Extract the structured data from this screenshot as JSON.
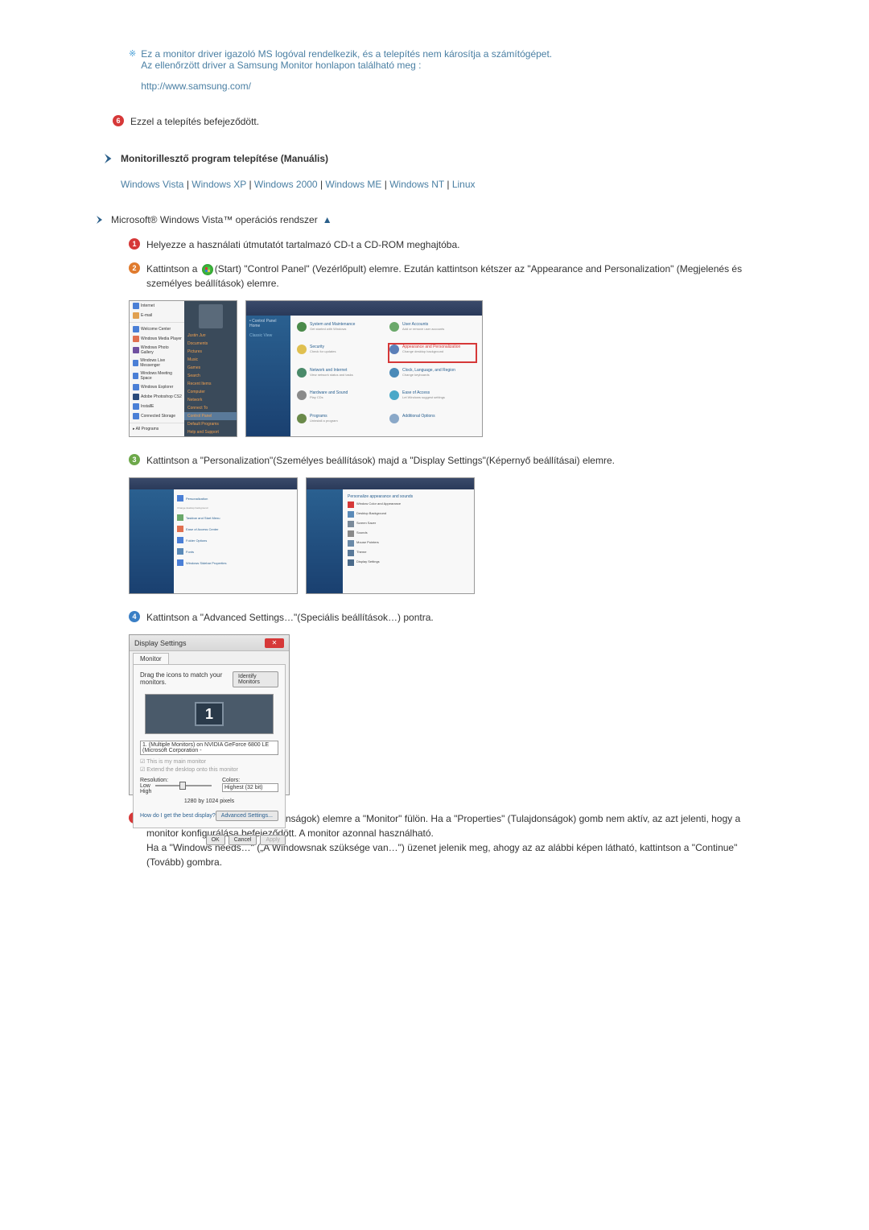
{
  "note": {
    "line1": "Ez a monitor driver igazoló MS logóval rendelkezik, és a telepítés nem károsítja a számítógépet.",
    "line2": "Az ellenőrzött driver a Samsung Monitor honlapon található meg :",
    "url": "http://www.samsung.com/"
  },
  "step6": "Ezzel a telepítés befejeződött.",
  "section_manual": "Monitorillesztő program telepítése (Manuális)",
  "os_links": {
    "vista": "Windows Vista",
    "xp": "Windows XP",
    "w2000": "Windows 2000",
    "me": "Windows ME",
    "nt": "Windows NT",
    "linux": "Linux"
  },
  "vista_title": "Microsoft® Windows Vista™ operációs rendszer",
  "vista_steps": {
    "s1": "Helyezze a használati útmutatót tartalmazó CD-t a CD-ROM meghajtóba.",
    "s2a": "Kattintson a ",
    "s2b": "(Start) \"Control Panel\" (Vezérlőpult) elemre. Ezután kattintson kétszer az \"Appearance and Personalization\" (Megjelenés és személyes beállítások) elemre.",
    "s3": "Kattintson a \"Personalization\"(Személyes beállítások) majd a \"Display Settings\"(Képernyő beállításai) elemre.",
    "s4": "Kattintson a \"Advanced Settings…\"(Speciális beállítások…) pontra.",
    "s5": "Kattintson a \"Properties\"(Tulajdonságok) elemre a \"Monitor\" fülön. Ha a \"Properties\" (Tulajdonságok) gomb nem aktív, az azt jelenti, hogy a monitor konfigurálása befejeződött. A monitor azonnal használható.\nHa a \"Windows needs…\" („A Windowsnak szüksége van…\") üzenet jelenik meg, ahogy az az alábbi képen látható, kattintson a \"Continue\"(Tovább) gombra."
  },
  "display_settings": {
    "title": "Display Settings",
    "tab": "Monitor",
    "instruction": "Drag the icons to match your monitors.",
    "identify_btn": "Identify Monitors",
    "monitor_num": "1",
    "dropdown": "1. (Multiple Monitors) on NVIDIA GeForce 6800 LE (Microsoft Corporation -",
    "checkbox1": "This is my main monitor",
    "checkbox2": "Extend the desktop onto this monitor",
    "resolution_label": "Resolution:",
    "low": "Low",
    "high": "High",
    "colors_label": "Colors:",
    "colors_value": "Highest (32 bit)",
    "resolution": "1280 by 1024 pixels",
    "best_display": "How do I get the best display?",
    "advanced_btn": "Advanced Settings...",
    "ok": "OK",
    "cancel": "Cancel",
    "apply": "Apply"
  },
  "cp": {
    "system": "System and Maintenance",
    "user": "User Accounts",
    "security": "Security",
    "appearance": "Appearance and Personalization",
    "network": "Network and Internet",
    "clock": "Clock, Language, and Region",
    "hardware": "Hardware and Sound",
    "ease": "Ease of Access",
    "programs": "Programs",
    "additional": "Additional Options"
  }
}
